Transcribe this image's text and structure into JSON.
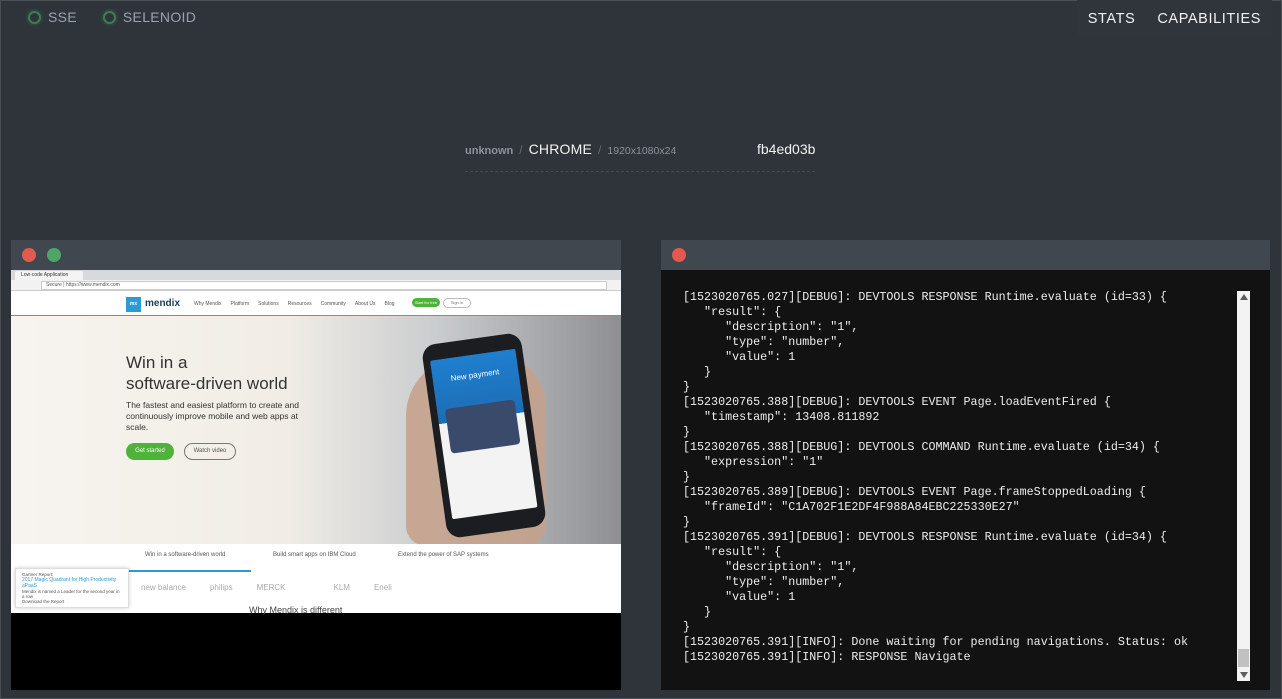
{
  "status": [
    {
      "label": "SSE"
    },
    {
      "label": "SELENOID"
    }
  ],
  "topnav": {
    "stats": "STATS",
    "capabilities": "CAPABILITIES"
  },
  "session": {
    "user": "unknown",
    "browser": "CHROME",
    "resolution": "1920x1080x24",
    "id": "fb4ed03b"
  },
  "colors": {
    "close": "#e05a4f",
    "maximize": "#4ea56a",
    "status_ok": "#3f7a57"
  },
  "vnc": {
    "page": {
      "tab_title": "Low-code Application Platform | Mendix",
      "url": "Secure | https://www.mendix.com",
      "logo": "mx",
      "brand": "mendix",
      "menu": [
        "Why Mendix",
        "Platform",
        "Solutions",
        "Resources",
        "Community",
        "About Us",
        "Blog"
      ],
      "cta_primary": "Start for free",
      "cta_secondary": "Sign In",
      "headline_line1": "Win in a",
      "headline_line2": "software-driven world",
      "subtext": "The fastest and easiest platform to create and continuously improve mobile and web apps at scale.",
      "btn_primary": "Get started",
      "btn_secondary": "Watch video",
      "phone_title": "New payment",
      "tabs": [
        "Win in a software-driven world",
        "Build smart apps on IBM Cloud",
        "Extend the power of SAP systems"
      ],
      "popup_title": "Gartner Report:",
      "popup_link": "2017 Magic Quadrant for High Productivity aPaaS",
      "popup_body": "Mendix is named a Leader for the second year in a row",
      "popup_action": "Download the Report",
      "logos": [
        "new balance",
        "philips",
        "MERCK",
        "",
        "KLM",
        "Eneli"
      ],
      "bottom_heading": "Why Mendix is different"
    }
  },
  "logs": {
    "lines": [
      "[1523020765.027][DEBUG]: DEVTOOLS RESPONSE Runtime.evaluate (id=33) {",
      "   \"result\": {",
      "      \"description\": \"1\",",
      "      \"type\": \"number\",",
      "      \"value\": 1",
      "   }",
      "}",
      "[1523020765.388][DEBUG]: DEVTOOLS EVENT Page.loadEventFired {",
      "   \"timestamp\": 13408.811892",
      "}",
      "[1523020765.388][DEBUG]: DEVTOOLS COMMAND Runtime.evaluate (id=34) {",
      "   \"expression\": \"1\"",
      "}",
      "[1523020765.389][DEBUG]: DEVTOOLS EVENT Page.frameStoppedLoading {",
      "   \"frameId\": \"C1A702F1E2DF4F988A84EBC225330E27\"",
      "}",
      "[1523020765.391][DEBUG]: DEVTOOLS RESPONSE Runtime.evaluate (id=34) {",
      "   \"result\": {",
      "      \"description\": \"1\",",
      "      \"type\": \"number\",",
      "      \"value\": 1",
      "   }",
      "}",
      "[1523020765.391][INFO]: Done waiting for pending navigations. Status: ok",
      "[1523020765.391][INFO]: RESPONSE Navigate"
    ]
  }
}
